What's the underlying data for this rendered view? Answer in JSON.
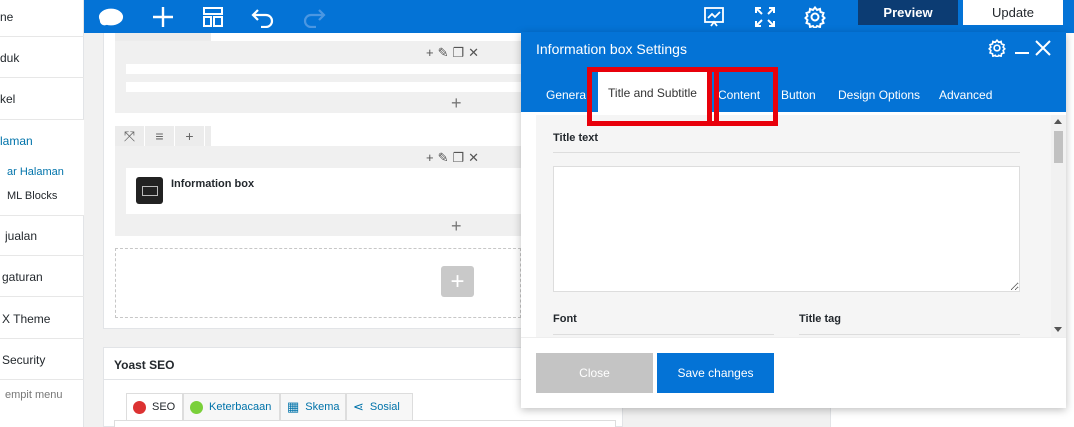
{
  "sidebar": {
    "items": [
      {
        "label": "ne"
      },
      {
        "label": "duk"
      },
      {
        "label": "kel"
      },
      {
        "label": "laman"
      },
      {
        "label": "ar Halaman"
      },
      {
        "label": "ML Blocks"
      },
      {
        "label": "jualan"
      },
      {
        "label": "gaturan"
      },
      {
        "label": "X Theme"
      },
      {
        "label": "Security"
      },
      {
        "label": "empit menu"
      }
    ]
  },
  "toolbar": {
    "preview_label": "Preview",
    "update_label": "Update"
  },
  "canvas": {
    "element_label": "Information box"
  },
  "yoast": {
    "title": "Yoast SEO",
    "tabs": [
      {
        "label": "SEO",
        "color": "#dc3232"
      },
      {
        "label": "Keterbacaan",
        "color": "#7ad03a"
      },
      {
        "label": "Skema",
        "color": "#0073aa"
      },
      {
        "label": "Sosial",
        "color": "#0073aa"
      }
    ]
  },
  "modal": {
    "title": "Information box Settings",
    "tabs": [
      {
        "label": "General"
      },
      {
        "label": "Title and Subtitle"
      },
      {
        "label": "Content"
      },
      {
        "label": "Button"
      },
      {
        "label": "Design Options"
      },
      {
        "label": "Advanced"
      }
    ],
    "fields": {
      "title_text_label": "Title text",
      "title_text_value": "",
      "font_label": "Font",
      "title_tag_label": "Title tag"
    },
    "close_label": "Close",
    "save_label": "Save changes"
  },
  "colors": {
    "toolbar_bg": "#0473d6",
    "preview_bg": "#0c3c73",
    "highlight": "#e8000b"
  }
}
